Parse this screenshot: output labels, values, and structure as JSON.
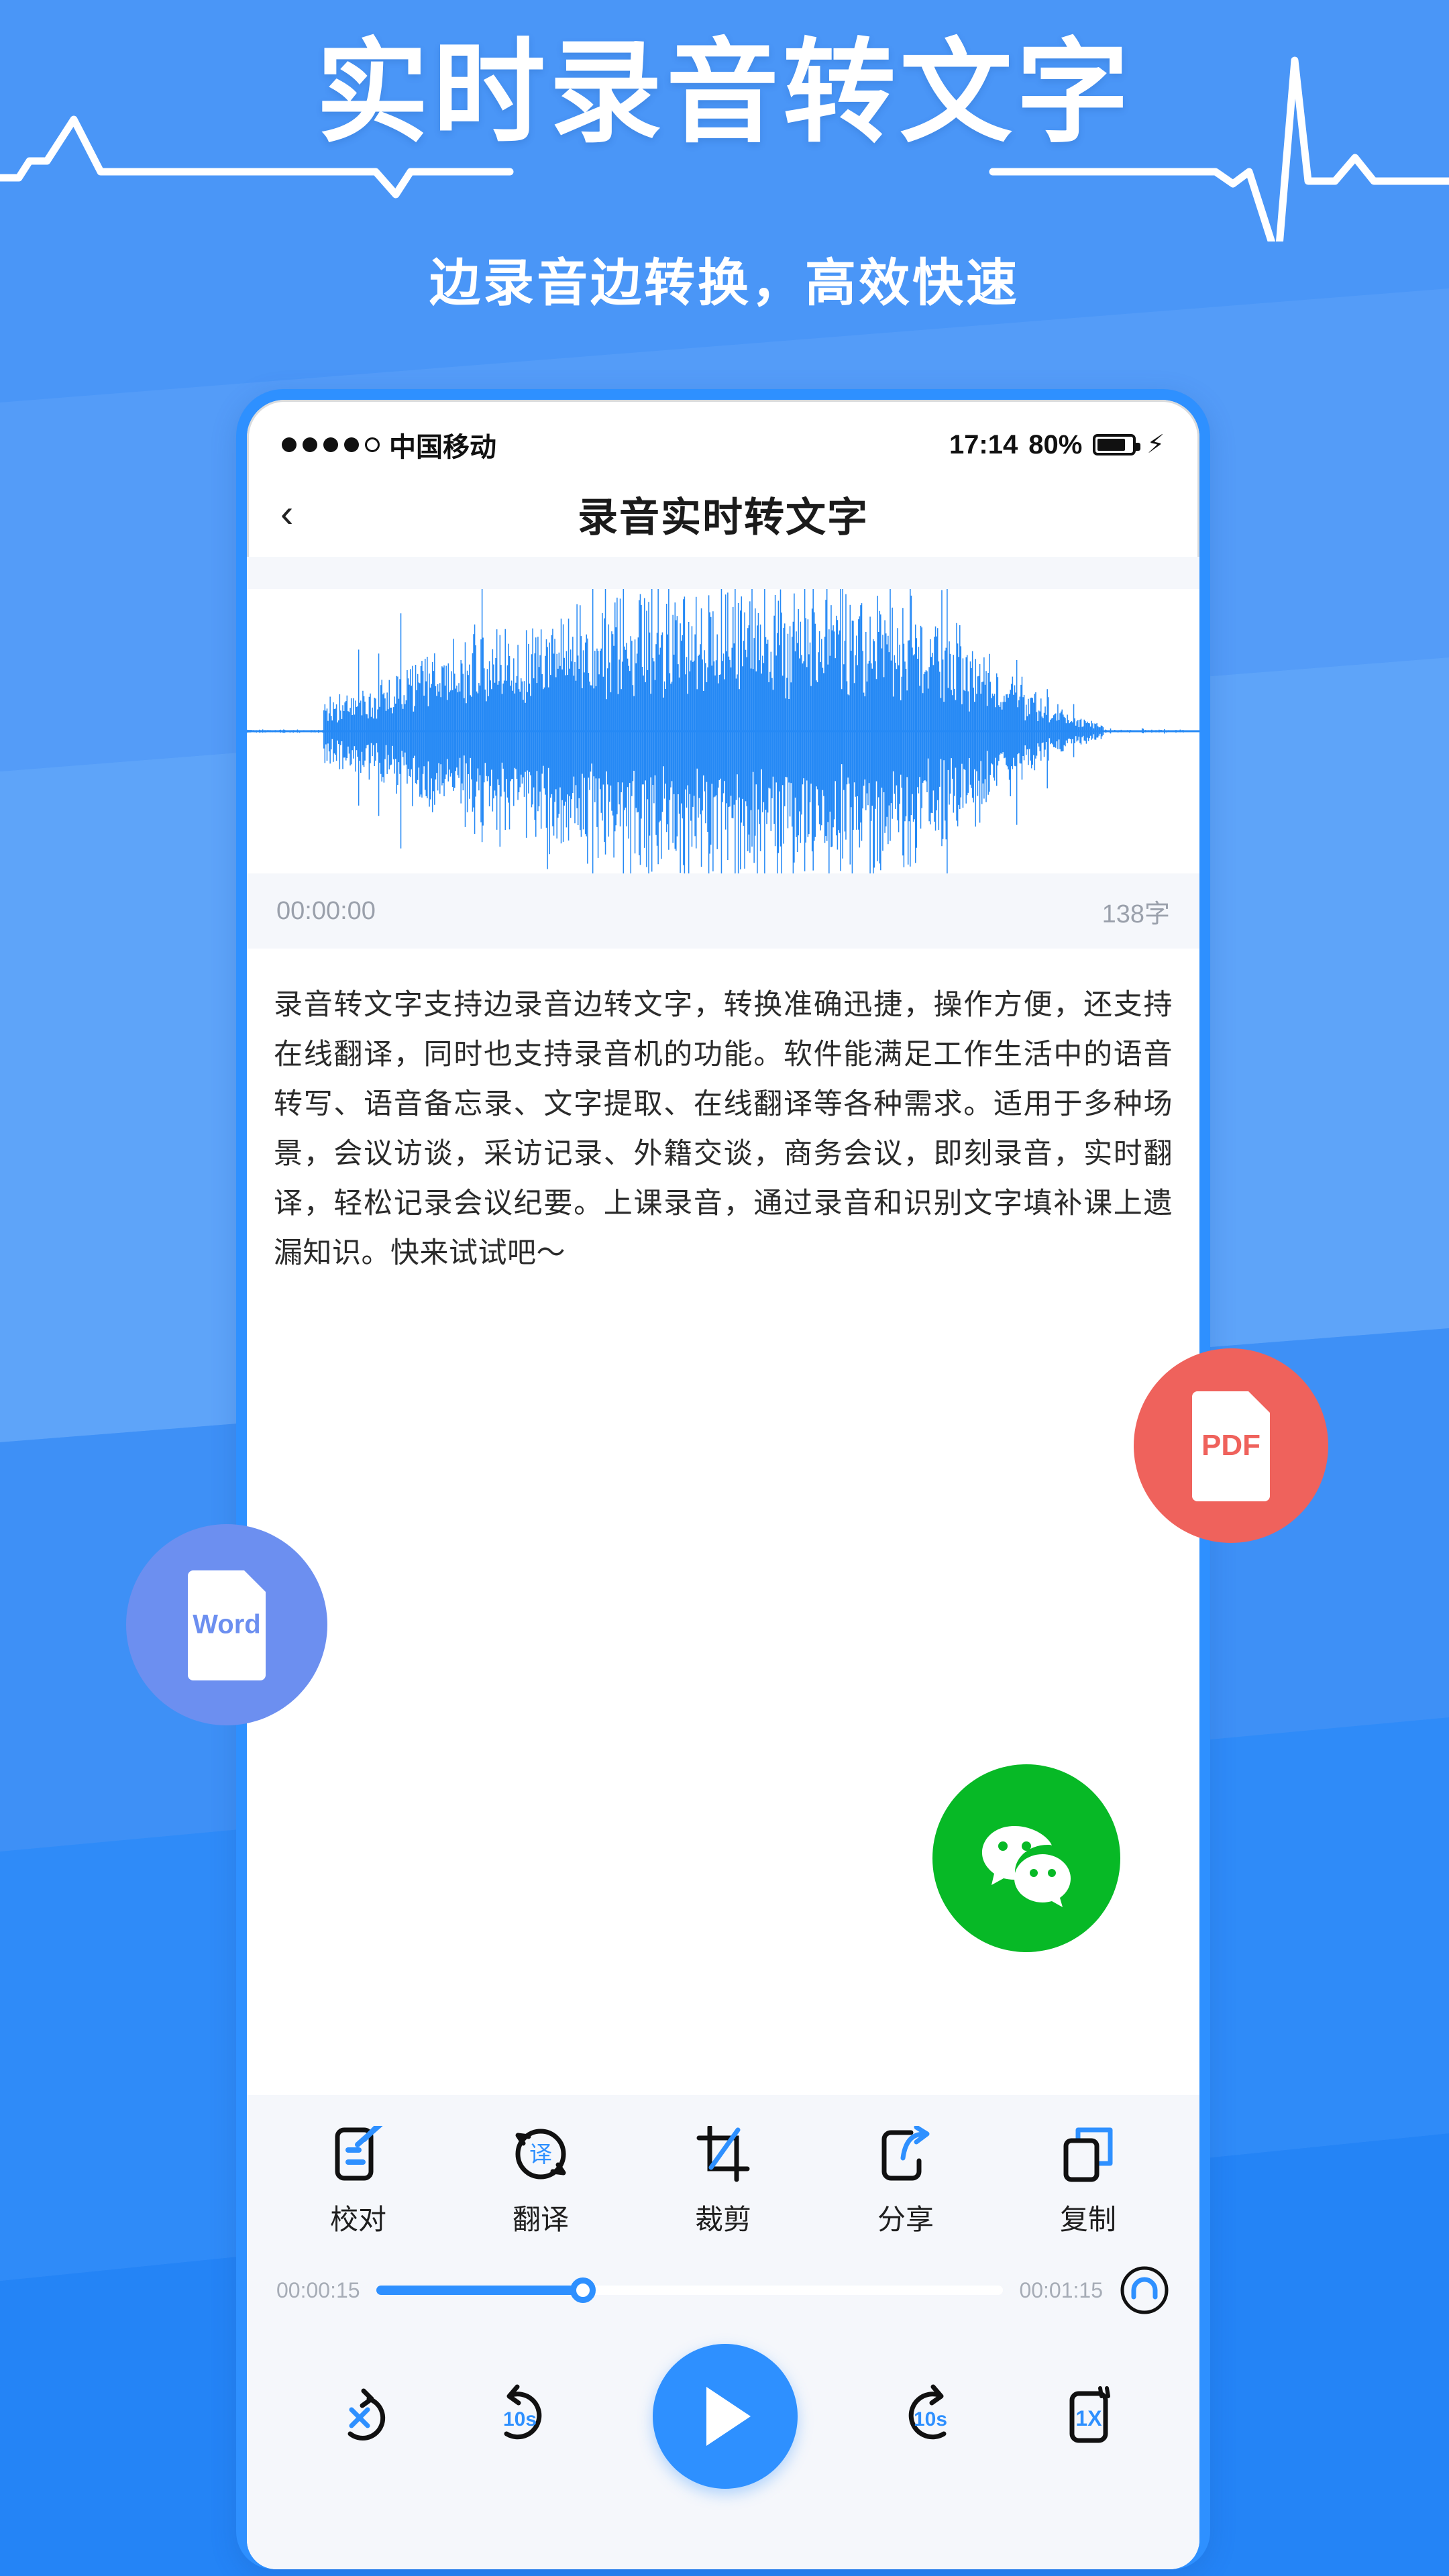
{
  "hero": {
    "title": "实时录音转文字",
    "subtitle": "边录音边转换，高效快速"
  },
  "colors": {
    "page_bg": "#4A96F7",
    "phone_frame": "#2E90FF",
    "accent_blue": "#2E90FF",
    "waveform_blue": "#2589F5",
    "pdf_red": "#EF625C",
    "word_blue": "#6C8FF0",
    "wechat_green": "#07B926",
    "panel_grey": "#F5F7FB",
    "muted_text": "#9AA0AB"
  },
  "phone": {
    "status_bar": {
      "carrier": "中国移动",
      "signal_dots_filled": 4,
      "signal_dots_total": 5,
      "time": "17:14",
      "battery_percent": "80%",
      "charging_icon": "bolt-icon"
    },
    "nav": {
      "back_icon": "chevron-left-icon",
      "title": "录音实时转文字"
    },
    "recorder": {
      "waveform_icon": "audio-waveform",
      "elapsed_time": "00:00:00",
      "char_count": "138字"
    },
    "transcript": "录音转文字支持边录音边转文字，转换准确迅捷，操作方便，还支持在线翻译，同时也支持录音机的功能。软件能满足工作生活中的语音转写、语音备忘录、文字提取、在线翻译等各种需求。适用于多种场景，会议访谈，采访记录、外籍交谈，商务会议，即刻录音，实时翻译，轻松记录会议纪要。上课录音，通过录音和识别文字填补课上遗漏知识。快来试试吧～",
    "toolbar": [
      {
        "label": "校对",
        "icon": "proofread-icon"
      },
      {
        "label": "翻译",
        "icon": "translate-icon"
      },
      {
        "label": "裁剪",
        "icon": "crop-icon"
      },
      {
        "label": "分享",
        "icon": "share-icon"
      },
      {
        "label": "复制",
        "icon": "copy-icon"
      }
    ],
    "progress": {
      "current_time": "00:00:15",
      "total_time": "00:01:15",
      "percent": 33,
      "headphone_icon": "headphone-icon"
    },
    "player": [
      {
        "name": "loop-off-button",
        "icon": "loop-off-icon",
        "label": "X"
      },
      {
        "name": "rewind-button",
        "icon": "rewind-10s-icon",
        "label": "10s"
      },
      {
        "name": "play-button",
        "icon": "play-icon",
        "label": ""
      },
      {
        "name": "forward-button",
        "icon": "forward-10s-icon",
        "label": "10s"
      },
      {
        "name": "speed-button",
        "icon": "playback-speed-icon",
        "label": "1X"
      }
    ]
  },
  "badges": [
    {
      "id": "pdf",
      "label": "PDF",
      "icon": "pdf-file-icon"
    },
    {
      "id": "word",
      "label": "Word",
      "icon": "word-file-icon"
    },
    {
      "id": "wechat",
      "label": "",
      "icon": "wechat-icon"
    }
  ]
}
